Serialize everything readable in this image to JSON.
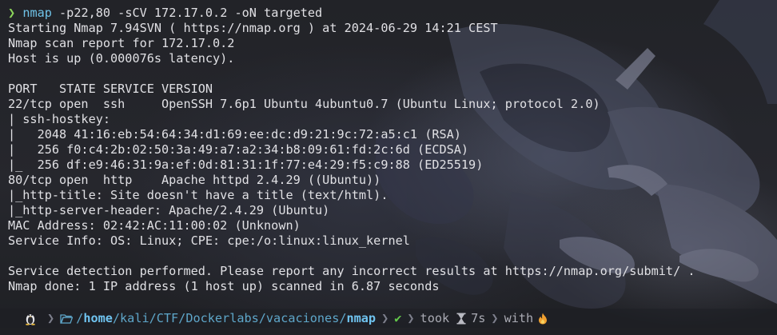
{
  "command": {
    "prompt_symbol": "❯",
    "program": "nmap",
    "arguments": " -p22,80 -sCV 172.17.0.2 -oN targeted"
  },
  "output_lines": [
    "Starting Nmap 7.94SVN ( https://nmap.org ) at 2024-06-29 14:21 CEST",
    "Nmap scan report for 172.17.0.2",
    "Host is up (0.000076s latency).",
    "",
    "PORT   STATE SERVICE VERSION",
    "22/tcp open  ssh     OpenSSH 7.6p1 Ubuntu 4ubuntu0.7 (Ubuntu Linux; protocol 2.0)",
    "| ssh-hostkey:",
    "|   2048 41:16:eb:54:64:34:d1:69:ee:dc:d9:21:9c:72:a5:c1 (RSA)",
    "|   256 f0:c4:2b:02:50:3a:49:a7:a2:34:b8:09:61:fd:2c:6d (ECDSA)",
    "|_  256 df:e9:46:31:9a:ef:0d:81:31:1f:77:e4:29:f5:c9:88 (ED25519)",
    "80/tcp open  http    Apache httpd 2.4.29 ((Ubuntu))",
    "|_http-title: Site doesn't have a title (text/html).",
    "|_http-server-header: Apache/2.4.29 (Ubuntu)",
    "MAC Address: 02:42:AC:11:00:02 (Unknown)",
    "Service Info: OS: Linux; CPE: cpe:/o:linux:linux_kernel",
    "",
    "Service detection performed. Please report any incorrect results at https://nmap.org/submit/ .",
    "Nmap done: 1 IP address (1 host up) scanned in 6.87 seconds"
  ],
  "status_bar": {
    "os_icon": "linux-penguin-icon",
    "path_prefix": "/home/kali/CTF/Dockerlabs/vacaciones/",
    "path_home": "home",
    "path_middle": "/kali/CTF/Dockerlabs/vacaciones/",
    "path_current": "nmap",
    "status_symbol": "✔",
    "took_label": "took",
    "duration": "7s",
    "with_label": "with"
  },
  "colors": {
    "background": "#232428",
    "text": "#e0e0e4",
    "prompt_accent": "#8bd45a",
    "command_name": "#6fc3e8",
    "path": "#5ea6c9",
    "success": "#64c94a"
  }
}
